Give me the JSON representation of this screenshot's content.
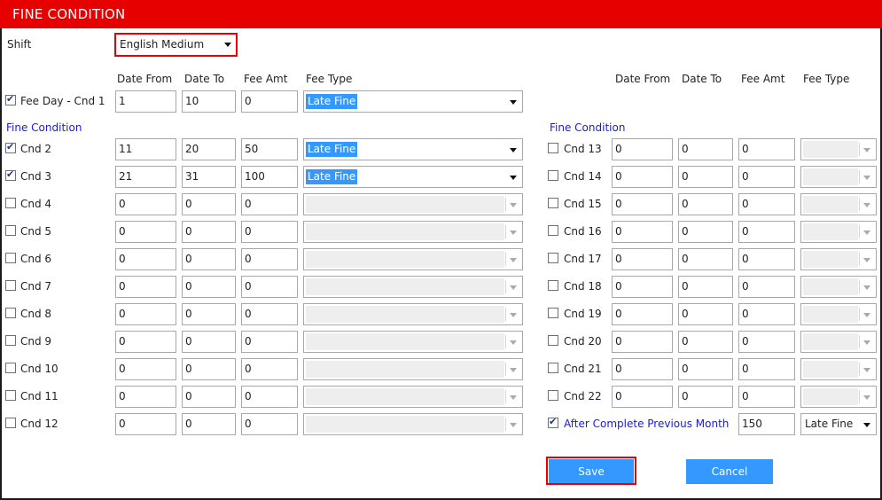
{
  "title": "FINE CONDITION",
  "shift": {
    "label": "Shift",
    "value": "English Medium"
  },
  "headers": {
    "date_from": "Date From",
    "date_to": "Date To",
    "fee_amt": "Fee Amt",
    "fee_type": "Fee Type"
  },
  "fine_condition_label": "Fine Condition",
  "fee_day": {
    "label": "Fee Day - Cnd 1",
    "checked": true,
    "date_from": "1",
    "date_to": "10",
    "fee_amt": "0",
    "fee_type": "Late Fine"
  },
  "left_rows": [
    {
      "label": "Cnd 2",
      "checked": true,
      "date_from": "11",
      "date_to": "20",
      "fee_amt": "50",
      "fee_type": "Late Fine"
    },
    {
      "label": "Cnd 3",
      "checked": true,
      "date_from": "21",
      "date_to": "31",
      "fee_amt": "100",
      "fee_type": "Late Fine"
    },
    {
      "label": "Cnd 4",
      "checked": false,
      "date_from": "0",
      "date_to": "0",
      "fee_amt": "0",
      "fee_type": ""
    },
    {
      "label": "Cnd 5",
      "checked": false,
      "date_from": "0",
      "date_to": "0",
      "fee_amt": "0",
      "fee_type": ""
    },
    {
      "label": "Cnd 6",
      "checked": false,
      "date_from": "0",
      "date_to": "0",
      "fee_amt": "0",
      "fee_type": ""
    },
    {
      "label": "Cnd 7",
      "checked": false,
      "date_from": "0",
      "date_to": "0",
      "fee_amt": "0",
      "fee_type": ""
    },
    {
      "label": "Cnd 8",
      "checked": false,
      "date_from": "0",
      "date_to": "0",
      "fee_amt": "0",
      "fee_type": ""
    },
    {
      "label": "Cnd 9",
      "checked": false,
      "date_from": "0",
      "date_to": "0",
      "fee_amt": "0",
      "fee_type": ""
    },
    {
      "label": "Cnd 10",
      "checked": false,
      "date_from": "0",
      "date_to": "0",
      "fee_amt": "0",
      "fee_type": ""
    },
    {
      "label": "Cnd 11",
      "checked": false,
      "date_from": "0",
      "date_to": "0",
      "fee_amt": "0",
      "fee_type": ""
    },
    {
      "label": "Cnd 12",
      "checked": false,
      "date_from": "0",
      "date_to": "0",
      "fee_amt": "0",
      "fee_type": ""
    }
  ],
  "right_rows": [
    {
      "label": "Cnd 13",
      "checked": false,
      "date_from": "0",
      "date_to": "0",
      "fee_amt": "0",
      "fee_type": ""
    },
    {
      "label": "Cnd 14",
      "checked": false,
      "date_from": "0",
      "date_to": "0",
      "fee_amt": "0",
      "fee_type": ""
    },
    {
      "label": "Cnd 15",
      "checked": false,
      "date_from": "0",
      "date_to": "0",
      "fee_amt": "0",
      "fee_type": ""
    },
    {
      "label": "Cnd 16",
      "checked": false,
      "date_from": "0",
      "date_to": "0",
      "fee_amt": "0",
      "fee_type": ""
    },
    {
      "label": "Cnd 17",
      "checked": false,
      "date_from": "0",
      "date_to": "0",
      "fee_amt": "0",
      "fee_type": ""
    },
    {
      "label": "Cnd 18",
      "checked": false,
      "date_from": "0",
      "date_to": "0",
      "fee_amt": "0",
      "fee_type": ""
    },
    {
      "label": "Cnd 19",
      "checked": false,
      "date_from": "0",
      "date_to": "0",
      "fee_amt": "0",
      "fee_type": ""
    },
    {
      "label": "Cnd 20",
      "checked": false,
      "date_from": "0",
      "date_to": "0",
      "fee_amt": "0",
      "fee_type": ""
    },
    {
      "label": "Cnd 21",
      "checked": false,
      "date_from": "0",
      "date_to": "0",
      "fee_amt": "0",
      "fee_type": ""
    },
    {
      "label": "Cnd 22",
      "checked": false,
      "date_from": "0",
      "date_to": "0",
      "fee_amt": "0",
      "fee_type": ""
    }
  ],
  "after_month": {
    "label": "After Complete Previous Month",
    "checked": true,
    "fee_amt": "150",
    "fee_type": "Late Fine"
  },
  "buttons": {
    "save": "Save",
    "cancel": "Cancel"
  },
  "colors": {
    "title_bar": "#e60000",
    "button": "#3399ff",
    "link_text": "#1a1adc",
    "highlight": "#3399ff"
  },
  "icons": {
    "dropdown": "chevron-down-icon",
    "checkbox": "checkbox-icon"
  }
}
